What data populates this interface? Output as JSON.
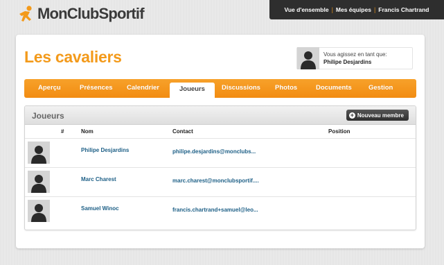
{
  "brand": {
    "name": "MonClubSportif",
    "accent": "#f39a1b"
  },
  "topnav": {
    "items": [
      "Vue d'ensemble",
      "Mes équipes",
      "Francis Chartrand"
    ]
  },
  "club": {
    "title": "Les cavaliers"
  },
  "acting_as": {
    "label": "Vous agissez en tant que:",
    "name": "Philipe Desjardins",
    "avatar_icon": "user-silhouette-icon"
  },
  "tabs": [
    {
      "label": "Aperçu",
      "active": false
    },
    {
      "label": "Présences",
      "active": false
    },
    {
      "label": "Calendrier",
      "active": false
    },
    {
      "label": "Joueurs",
      "active": true
    },
    {
      "label": "Discussions",
      "active": false
    },
    {
      "label": "Photos",
      "active": false
    },
    {
      "label": "Documents",
      "active": false
    },
    {
      "label": "Gestion",
      "active": false
    }
  ],
  "players_panel": {
    "title": "Joueurs",
    "new_button_label": "Nouveau membre",
    "columns": {
      "number": "#",
      "name": "Nom",
      "contact": "Contact",
      "position": "Position"
    },
    "rows": [
      {
        "number": "",
        "name": "Philipe Desjardins",
        "contact": "philipe.desjardins@monclubs...",
        "position": ""
      },
      {
        "number": "",
        "name": "Marc Charest",
        "contact": "marc.charest@monclubsportif....",
        "position": ""
      },
      {
        "number": "",
        "name": "Samuel Winoc",
        "contact": "francis.chartrand+samuel@leo...",
        "position": ""
      }
    ]
  }
}
